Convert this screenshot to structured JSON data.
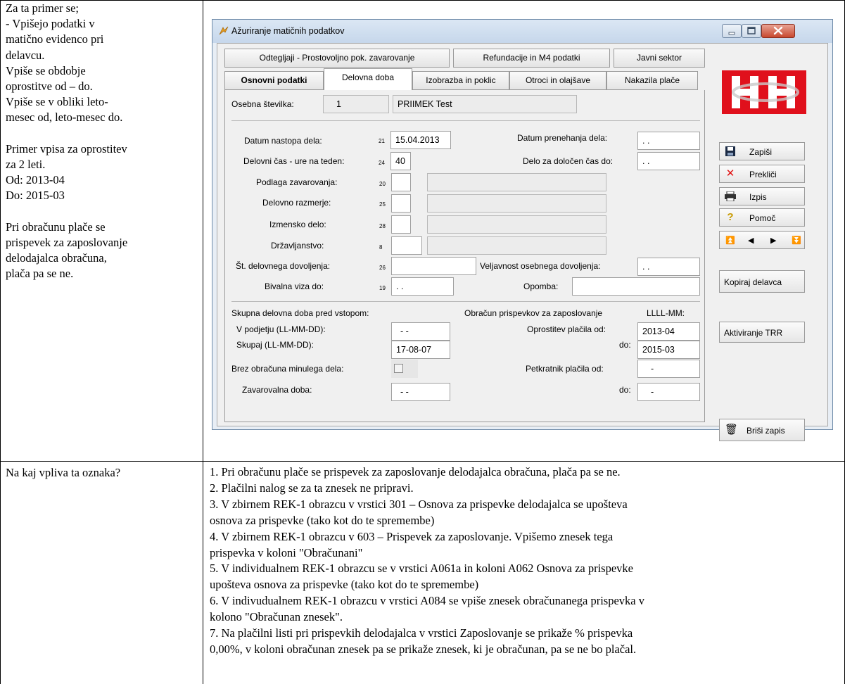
{
  "left_column": {
    "lines": [
      "Za ta primer se;",
      "- Vpišejo podatki v",
      "matično evidenco pri",
      "delavcu.",
      "Vpiše se obdobje",
      "oprostitve od – do.",
      "Vpiše se v obliki leto-",
      "mesec od, leto-mesec do.",
      "",
      "Primer vpisa za oprostitev",
      "za 2 leti.",
      "Od: 2013-04",
      "Do: 2015-03",
      "",
      "Pri obračunu plače se",
      "prispevek za zaposlovanje",
      "delodajalca obračuna,",
      "plača pa se ne."
    ]
  },
  "window": {
    "title": "Ažuriranje matičnih podatkov",
    "tabs_row1": [
      "Odtegljaji - Prostovoljno pok. zavarovanje",
      "Refundacije in M4 podatki",
      "Javni sektor"
    ],
    "tabs_row2": [
      "Osnovni podatki",
      "Delovna doba",
      "Izobrazba in poklic",
      "Otroci in olajšave",
      "Nakazila plače"
    ],
    "header": {
      "osebna_label": "Osebna številka:",
      "osebna_value": "1",
      "name_value": "PRIIMEK Test"
    },
    "form": {
      "datum_nastopa_label": "Datum nastopa dela:",
      "datum_nastopa_code": "21",
      "datum_nastopa_value": "15.04.2013",
      "datum_prenehanja_label": "Datum prenehanja dela:",
      "datum_prenehanja_value": ". .",
      "delovni_cas_label": "Delovni čas - ure na teden:",
      "delovni_cas_code": "24",
      "delovni_cas_value": "40",
      "delo_dolocen_label": "Delo za določen čas do:",
      "delo_dolocen_value": ". .",
      "podlaga_label": "Podlaga zavarovanja:",
      "podlaga_code": "20",
      "razmerje_label": "Delovno razmerje:",
      "razmerje_code": "25",
      "izmensko_label": "Izmensko delo:",
      "izmensko_code": "28",
      "drzavljanstvo_label": "Državljanstvo:",
      "drzavljanstvo_code": "8",
      "st_dovoljenja_label": "Št. delovnega dovoljenja:",
      "st_dovoljenja_code": "26",
      "veljavnost_label": "Veljavnost osebnega dovoljenja:",
      "veljavnost_value": ". .",
      "bivalna_label": "Bivalna viza do:",
      "bivalna_code": "19",
      "bivalna_value": ". .",
      "opomba_label": "Opomba:",
      "skupna_label": "Skupna delovna doba pred vstopom:",
      "obracun_label": "Obračun prispevkov za zaposlovanje",
      "obracun_format": "LLLL-MM:",
      "podjetju_label": "V podjetju (LL-MM-DD):",
      "podjetju_value": "- -",
      "oprostitev_od_label": "Oprostitev plačila od:",
      "oprostitev_od_value": "2013-04",
      "skupaj_label": "Skupaj (LL-MM-DD):",
      "skupaj_value": "17-08-07",
      "do_label": "do:",
      "oprostitev_do_value": "2015-03",
      "brez_label": "Brez obračuna minulega dela:",
      "petkratnik_label": "Petkratnik plačila od:",
      "petkratnik_od_value": "-",
      "zavarovalna_label": "Zavarovalna doba:",
      "zavarovalna_value": "- -",
      "do2_label": "do:",
      "petkratnik_do_value": "-"
    },
    "side_buttons": {
      "zapisi": "Zapiši",
      "preklici": "Prekliči",
      "izpis": "Izpis",
      "pomoc": "Pomoč",
      "kopiraj": "Kopiraj delavca",
      "aktiviranje": "Aktiviranje TRR",
      "brisi": "Briši zapis"
    }
  },
  "question": "Na kaj vpliva ta oznaka?",
  "answer_lines": [
    "1. Pri obračunu plače se prispevek za zaposlovanje delodajalca obračuna, plača pa se ne.",
    "2. Plačilni nalog se za ta znesek ne pripravi.",
    "3. V zbirnem REK-1 obrazcu v vrstici 301 – Osnova za prispevke delodajalca se upošteva",
    "osnova za prispevke (tako kot do te spremembe)",
    "4. V zbirnem REK-1 obrazcu v 603 – Prispevek za zaposlovanje. Vpišemo znesek tega",
    "prispevka v koloni  \"Obračunani\"",
    "5. V individualnem REK-1 obrazcu se v vrstici A061a in koloni A062 Osnova za prispevke",
    "upošteva osnova za prispevke (tako kot do te spremembe)",
    "6. V indivudualnem REK-1 obrazcu v vrstici A084 se vpiše znesek obračunanega prispevka v",
    "kolono \"Obračunan znesek\".",
    "7. Na plačilni listi pri prispevkih delodajalca v vrstici Zaposlovanje se prikaže % prispevka",
    "0,00%, v koloni obračunan znesek pa se prikaže znesek, ki je obračunan, pa se ne bo plačal."
  ],
  "colors": {
    "logo_red": "#e0101c",
    "close_red": "#c8482e"
  }
}
